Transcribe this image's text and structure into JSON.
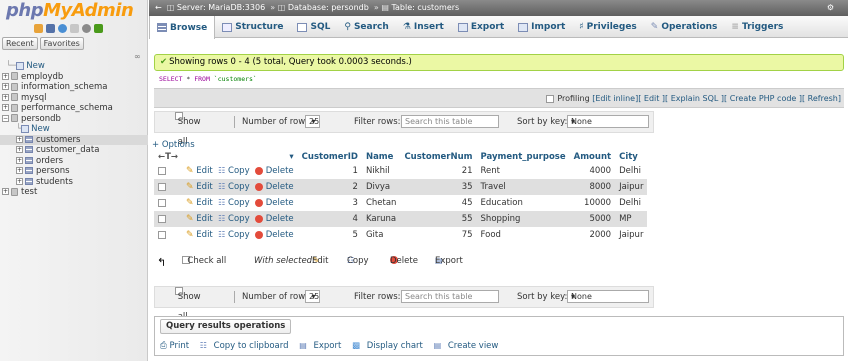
{
  "left_panel": {
    "logo": {
      "php": "php",
      "my": "My",
      "admin": "Admin"
    },
    "tabs": [
      "Recent",
      "Favorites"
    ],
    "tree": [
      {
        "label": "New",
        "level": 1,
        "type": "new"
      },
      {
        "label": "employdb",
        "level": 0,
        "type": "db"
      },
      {
        "label": "information_schema",
        "level": 0,
        "type": "db"
      },
      {
        "label": "mysql",
        "level": 0,
        "type": "db"
      },
      {
        "label": "performance_schema",
        "level": 0,
        "type": "db"
      },
      {
        "label": "persondb",
        "level": 0,
        "type": "db",
        "expanded": true
      },
      {
        "label": "New",
        "level": 2,
        "type": "new"
      },
      {
        "label": "customers",
        "level": 1,
        "type": "table",
        "selected": true
      },
      {
        "label": "customer_data",
        "level": 1,
        "type": "table"
      },
      {
        "label": "orders",
        "level": 1,
        "type": "table"
      },
      {
        "label": "persons",
        "level": 1,
        "type": "table"
      },
      {
        "label": "students",
        "level": 1,
        "type": "table"
      },
      {
        "label": "test",
        "level": 0,
        "type": "db"
      }
    ]
  },
  "breadcrumb": {
    "server": "Server: MariaDB:3306",
    "database": "Database: persondb",
    "table": "Table: customers"
  },
  "tabs": [
    {
      "label": "Browse",
      "icon": "browse-icon",
      "active": true
    },
    {
      "label": "Structure",
      "icon": "structure-icon"
    },
    {
      "label": "SQL",
      "icon": "sql-icon"
    },
    {
      "label": "Search",
      "icon": "search-icon"
    },
    {
      "label": "Insert",
      "icon": "insert-icon"
    },
    {
      "label": "Export",
      "icon": "export-icon"
    },
    {
      "label": "Import",
      "icon": "import-icon"
    },
    {
      "label": "Privileges",
      "icon": "privileges-icon"
    },
    {
      "label": "Operations",
      "icon": "operations-icon"
    },
    {
      "label": "Triggers",
      "icon": "triggers-icon"
    }
  ],
  "success_message": "Showing rows 0 - 4 (5 total, Query took 0.0003 seconds.)",
  "sql": {
    "keyword1": "SELECT",
    "star": " * ",
    "keyword2": "FROM",
    "table": " `customers`"
  },
  "profiling": {
    "label": "Profiling",
    "links": [
      "[Edit inline]",
      "[ Edit ]",
      "[ Explain SQL ]",
      "[ Create PHP code ]",
      "[ Refresh]"
    ]
  },
  "nav": {
    "show_all": "Show all",
    "rows_label": "Number of rows:",
    "rows_value": "25",
    "filter_label": "Filter rows:",
    "filter_placeholder": "Search this table",
    "sort_label": "Sort by key:",
    "sort_value": "None"
  },
  "options_label": "+ Options",
  "columns": [
    "CustomerID",
    "Name",
    "CustomerNum",
    "Payment_purpose",
    "Amount",
    "City"
  ],
  "row_actions": {
    "edit": "Edit",
    "copy": "Copy",
    "delete": "Delete"
  },
  "rows": [
    [
      "1",
      "Nikhil",
      "21",
      "Rent",
      "4000",
      "Delhi"
    ],
    [
      "2",
      "Divya",
      "35",
      "Travel",
      "8000",
      "Jaipur"
    ],
    [
      "3",
      "Chetan",
      "45",
      "Education",
      "10000",
      "Delhi"
    ],
    [
      "4",
      "Karuna",
      "55",
      "Shopping",
      "5000",
      "MP"
    ],
    [
      "5",
      "Gita",
      "75",
      "Food",
      "2000",
      "Jaipur"
    ]
  ],
  "bulk": {
    "check_all": "Check all",
    "with_selected": "With selected:",
    "edit": "Edit",
    "copy": "Copy",
    "delete": "Delete",
    "export": "Export"
  },
  "query_ops": {
    "legend": "Query results operations",
    "links": [
      "Print",
      "Copy to clipboard",
      "Export",
      "Display chart",
      "Create view"
    ]
  }
}
